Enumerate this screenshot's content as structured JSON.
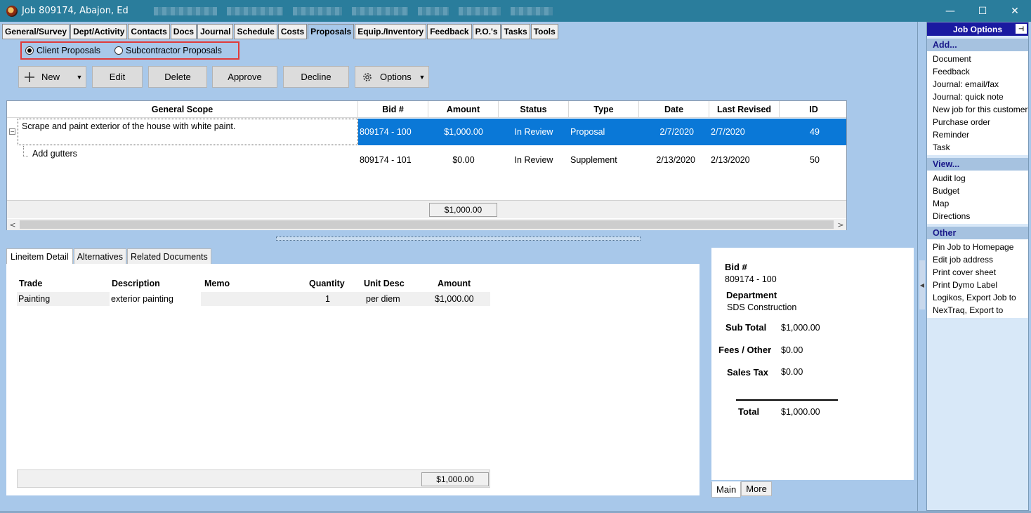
{
  "window": {
    "title": "Job 809174, Abajon, Ed",
    "controls": {
      "minimize": "—",
      "maximize": "☐",
      "close": "✕"
    }
  },
  "tabs": [
    "General/Survey",
    "Dept/Activity",
    "Contacts",
    "Docs",
    "Journal",
    "Schedule",
    "Costs",
    "Proposals",
    "Equip./Inventory",
    "Feedback",
    "P.O.'s",
    "Tasks",
    "Tools"
  ],
  "active_tab": "Proposals",
  "proposal_type": {
    "client_label": "Client Proposals",
    "sub_label": "Subcontractor Proposals",
    "selected": "client"
  },
  "toolbar": {
    "new_label": "New",
    "edit_label": "Edit",
    "delete_label": "Delete",
    "approve_label": "Approve",
    "decline_label": "Decline",
    "options_label": "Options"
  },
  "grid": {
    "columns": [
      "General Scope",
      "Bid #",
      "Amount",
      "Status",
      "Type",
      "Date",
      "Last Revised",
      "ID"
    ],
    "rows": [
      {
        "scope": "Scrape and paint exterior of the house with white paint.",
        "bid": "809174 - 100",
        "amount": "$1,000.00",
        "status": "In Review",
        "type": "Proposal",
        "date": "2/7/2020",
        "revised": "2/7/2020",
        "id": "49",
        "selected": true
      },
      {
        "scope": "Add gutters",
        "bid": "809174 - 101",
        "amount": "$0.00",
        "status": "In Review",
        "type": "Supplement",
        "date": "2/13/2020",
        "revised": "2/13/2020",
        "id": "50",
        "selected": false
      }
    ],
    "total": "$1,000.00"
  },
  "lower_tabs": [
    "Lineitem Detail",
    "Alternatives",
    "Related Documents"
  ],
  "lineitems": {
    "columns": [
      "Trade",
      "Description",
      "Memo",
      "Quantity",
      "Unit Desc",
      "Amount"
    ],
    "rows": [
      {
        "trade": "Painting",
        "description": "exterior painting",
        "memo": "",
        "quantity": "1",
        "unit": "per diem",
        "amount": "$1,000.00"
      }
    ],
    "total": "$1,000.00"
  },
  "summary": {
    "bid_label": "Bid #",
    "bid_value": "809174 - 100",
    "dept_label": "Department",
    "dept_value": "SDS Construction",
    "subtotal_label": "Sub Total",
    "subtotal_value": "$1,000.00",
    "fees_label": "Fees / Other",
    "fees_value": "$0.00",
    "tax_label": "Sales Tax",
    "tax_value": "$0.00",
    "total_label": "Total",
    "total_value": "$1,000.00",
    "tabs": [
      "Main",
      "More"
    ]
  },
  "job_options": {
    "title": "Job Options",
    "sections": [
      {
        "name": "Add...",
        "items": [
          "Document",
          "Feedback",
          "Journal: email/fax",
          "Journal: quick note",
          "New job for this customer",
          "Purchase order",
          "Reminder",
          "Task"
        ]
      },
      {
        "name": "View...",
        "items": [
          "Audit log",
          "Budget",
          "Map",
          "Directions"
        ]
      },
      {
        "name": "Other",
        "items": [
          "Pin Job to Homepage",
          "Edit job address",
          "Print cover sheet",
          "Print Dymo Label",
          "Logikos, Export Job to",
          "NexTraq, Export to"
        ]
      }
    ]
  },
  "colors": {
    "titlebar": "#2a7d9c",
    "selection": "#0a78d7",
    "background": "#a8c8ea",
    "highlight_border": "#e03a3a"
  }
}
